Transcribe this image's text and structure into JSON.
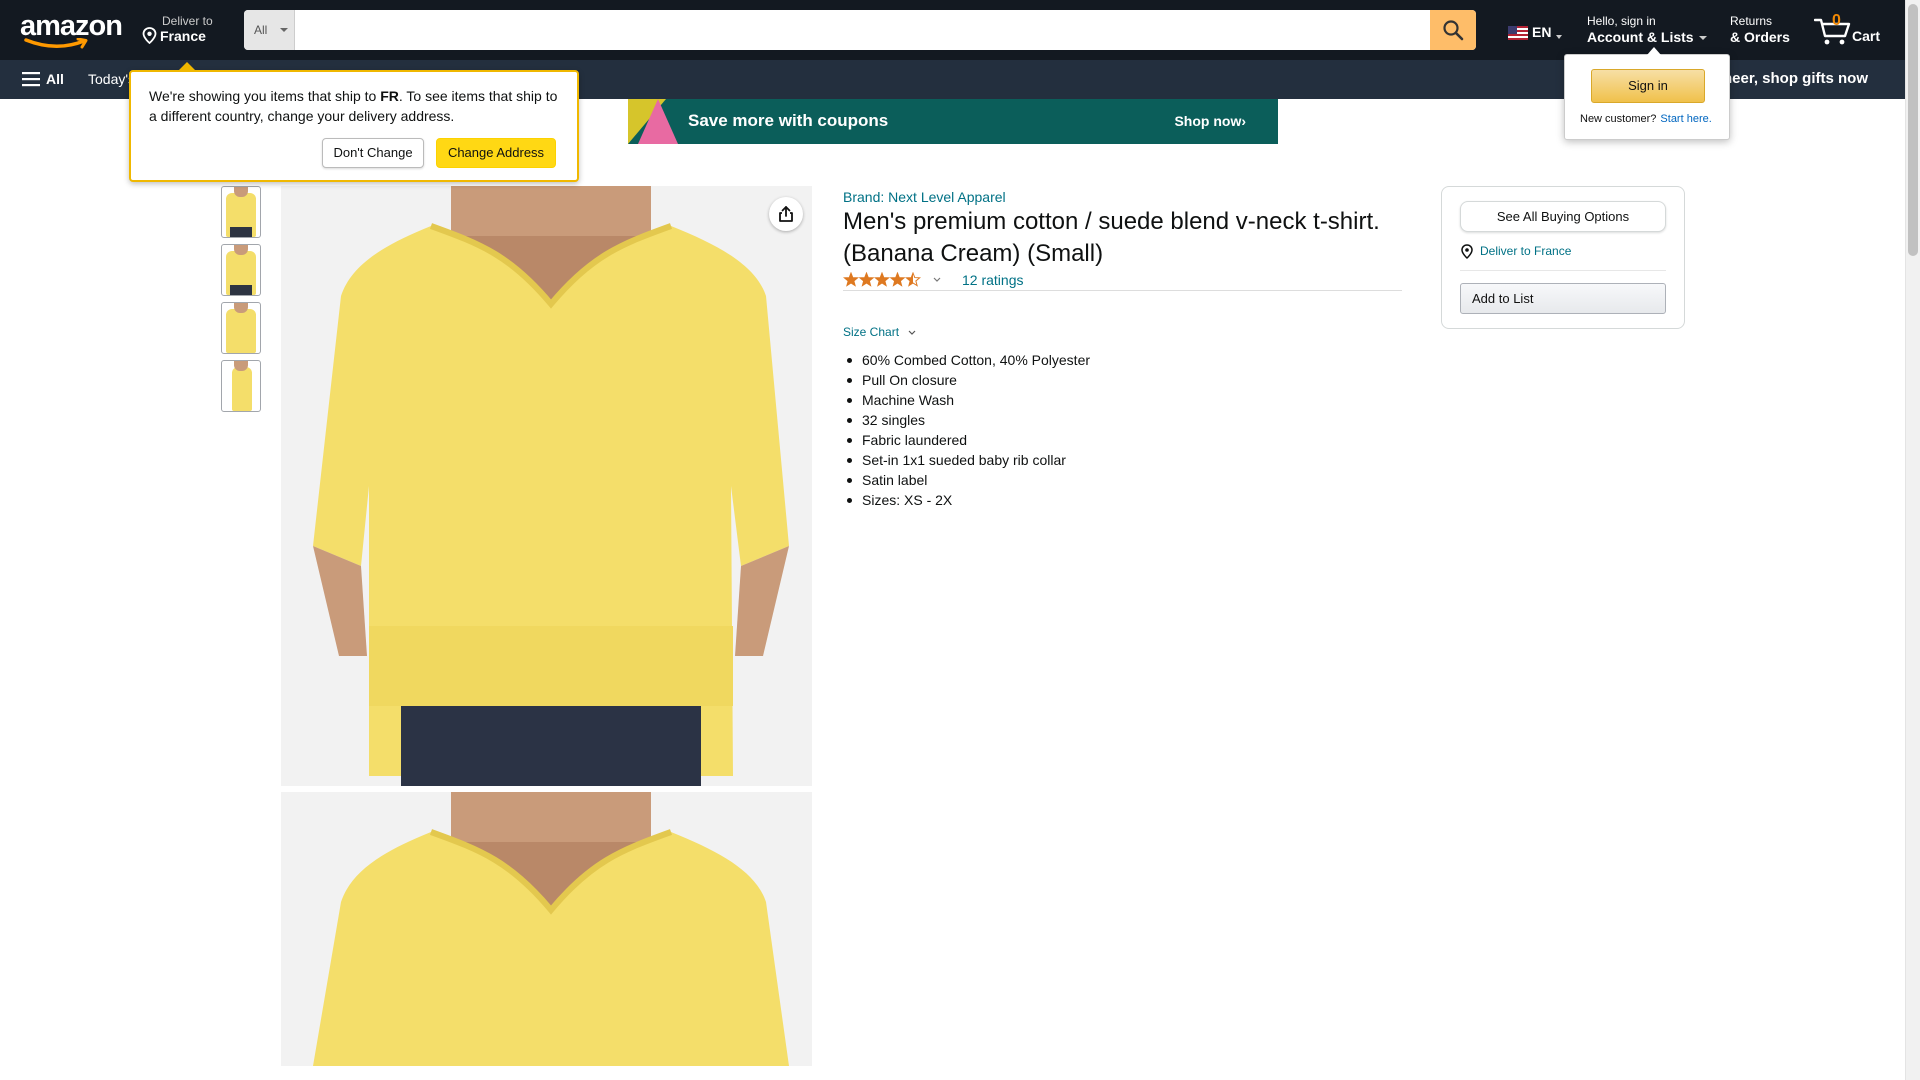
{
  "header": {
    "logo_text": "amazon",
    "deliver_small": "Deliver to",
    "deliver_big": "France",
    "search": {
      "category": "All",
      "placeholder": ""
    },
    "language": "EN",
    "account_small": "Hello, sign in",
    "account_big": "Account & Lists",
    "returns_small": "Returns",
    "returns_big": "& Orders",
    "cart_count": "0",
    "cart_label": "Cart"
  },
  "subnav": {
    "all_label": "All",
    "today_label": "Today's",
    "promo": "e cheer, shop gifts now"
  },
  "banner": {
    "text": "Save more with coupons",
    "shop": "Shop now›"
  },
  "delivery_popover": {
    "msg_part1": "We're showing you items that ship to ",
    "msg_country": "FR",
    "msg_part2": ". To see items that ship to a different country, change your delivery address.",
    "dont_change": "Don't Change",
    "change_address": "Change Address"
  },
  "signin_popover": {
    "sign_in": "Sign in",
    "new_customer": "New customer?",
    "start_here": "Start here."
  },
  "product": {
    "brand": "Brand: Next Level Apparel",
    "title": "Men's premium cotton / suede blend v-neck t-shirt. (Banana Cream) (Small)",
    "rating_value": 4.5,
    "ratings_count": "12 ratings",
    "size_chart": "Size Chart",
    "bullets": [
      "60% Combed Cotton, 40% Polyester",
      "Pull On closure",
      "Machine Wash",
      "32 singles",
      "Fabric laundered",
      "Set-in 1x1 sueded baby rib collar",
      "Satin label",
      "Sizes: XS - 2X"
    ]
  },
  "buybox": {
    "see_all": "See All Buying Options",
    "deliver_to": "Deliver to France",
    "add_to_list": "Add to List"
  },
  "colors": {
    "nav_dark": "#131921",
    "nav_sub": "#232f3e",
    "accent_orange": "#febd69",
    "link_teal": "#007185",
    "shirt_yellow": "#f4de6a"
  }
}
